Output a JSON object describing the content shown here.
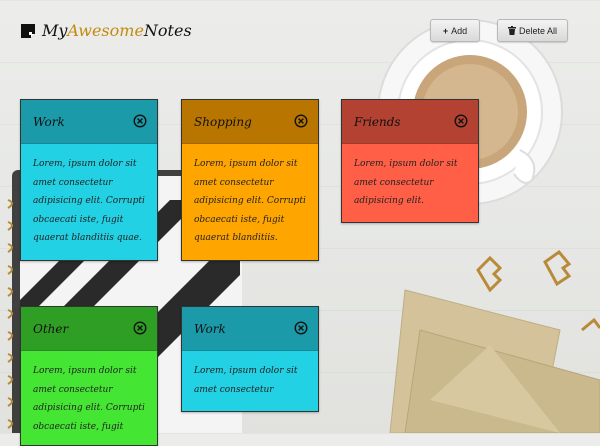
{
  "brand": {
    "part1": "My",
    "part2": "Awesome",
    "part3": "Notes"
  },
  "toolbar": {
    "add_label": "Add",
    "delete_all_label": "Delete All"
  },
  "notes": [
    {
      "title": "Work",
      "text": "Lorem, ipsum dolor sit amet consectetur adipisicing elit. Corrupti obcaecati iste, fugit quaerat blanditiis quae.",
      "header_color": "#1b9aaa",
      "body_color": "#22d1e3"
    },
    {
      "title": "Shopping",
      "text": "Lorem, ipsum dolor sit amet consectetur adipisicing elit. Corrupti obcaecati iste, fugit quaerat blanditiis.",
      "header_color": "#b87600",
      "body_color": "#ffa500"
    },
    {
      "title": "Friends",
      "text": "Lorem, ipsum dolor sit amet consectetur adipisicing elit.",
      "header_color": "#b34232",
      "body_color": "#ff5f47"
    },
    {
      "title": "Other",
      "text": "Lorem, ipsum dolor sit amet consectetur adipisicing elit. Corrupti obcaecati iste, fugit",
      "header_color": "#2f9e25",
      "body_color": "#45e533"
    },
    {
      "title": "Work",
      "text": "Lorem, ipsum dolor sit amet consectetur",
      "header_color": "#1b9aaa",
      "body_color": "#22d1e3"
    }
  ]
}
